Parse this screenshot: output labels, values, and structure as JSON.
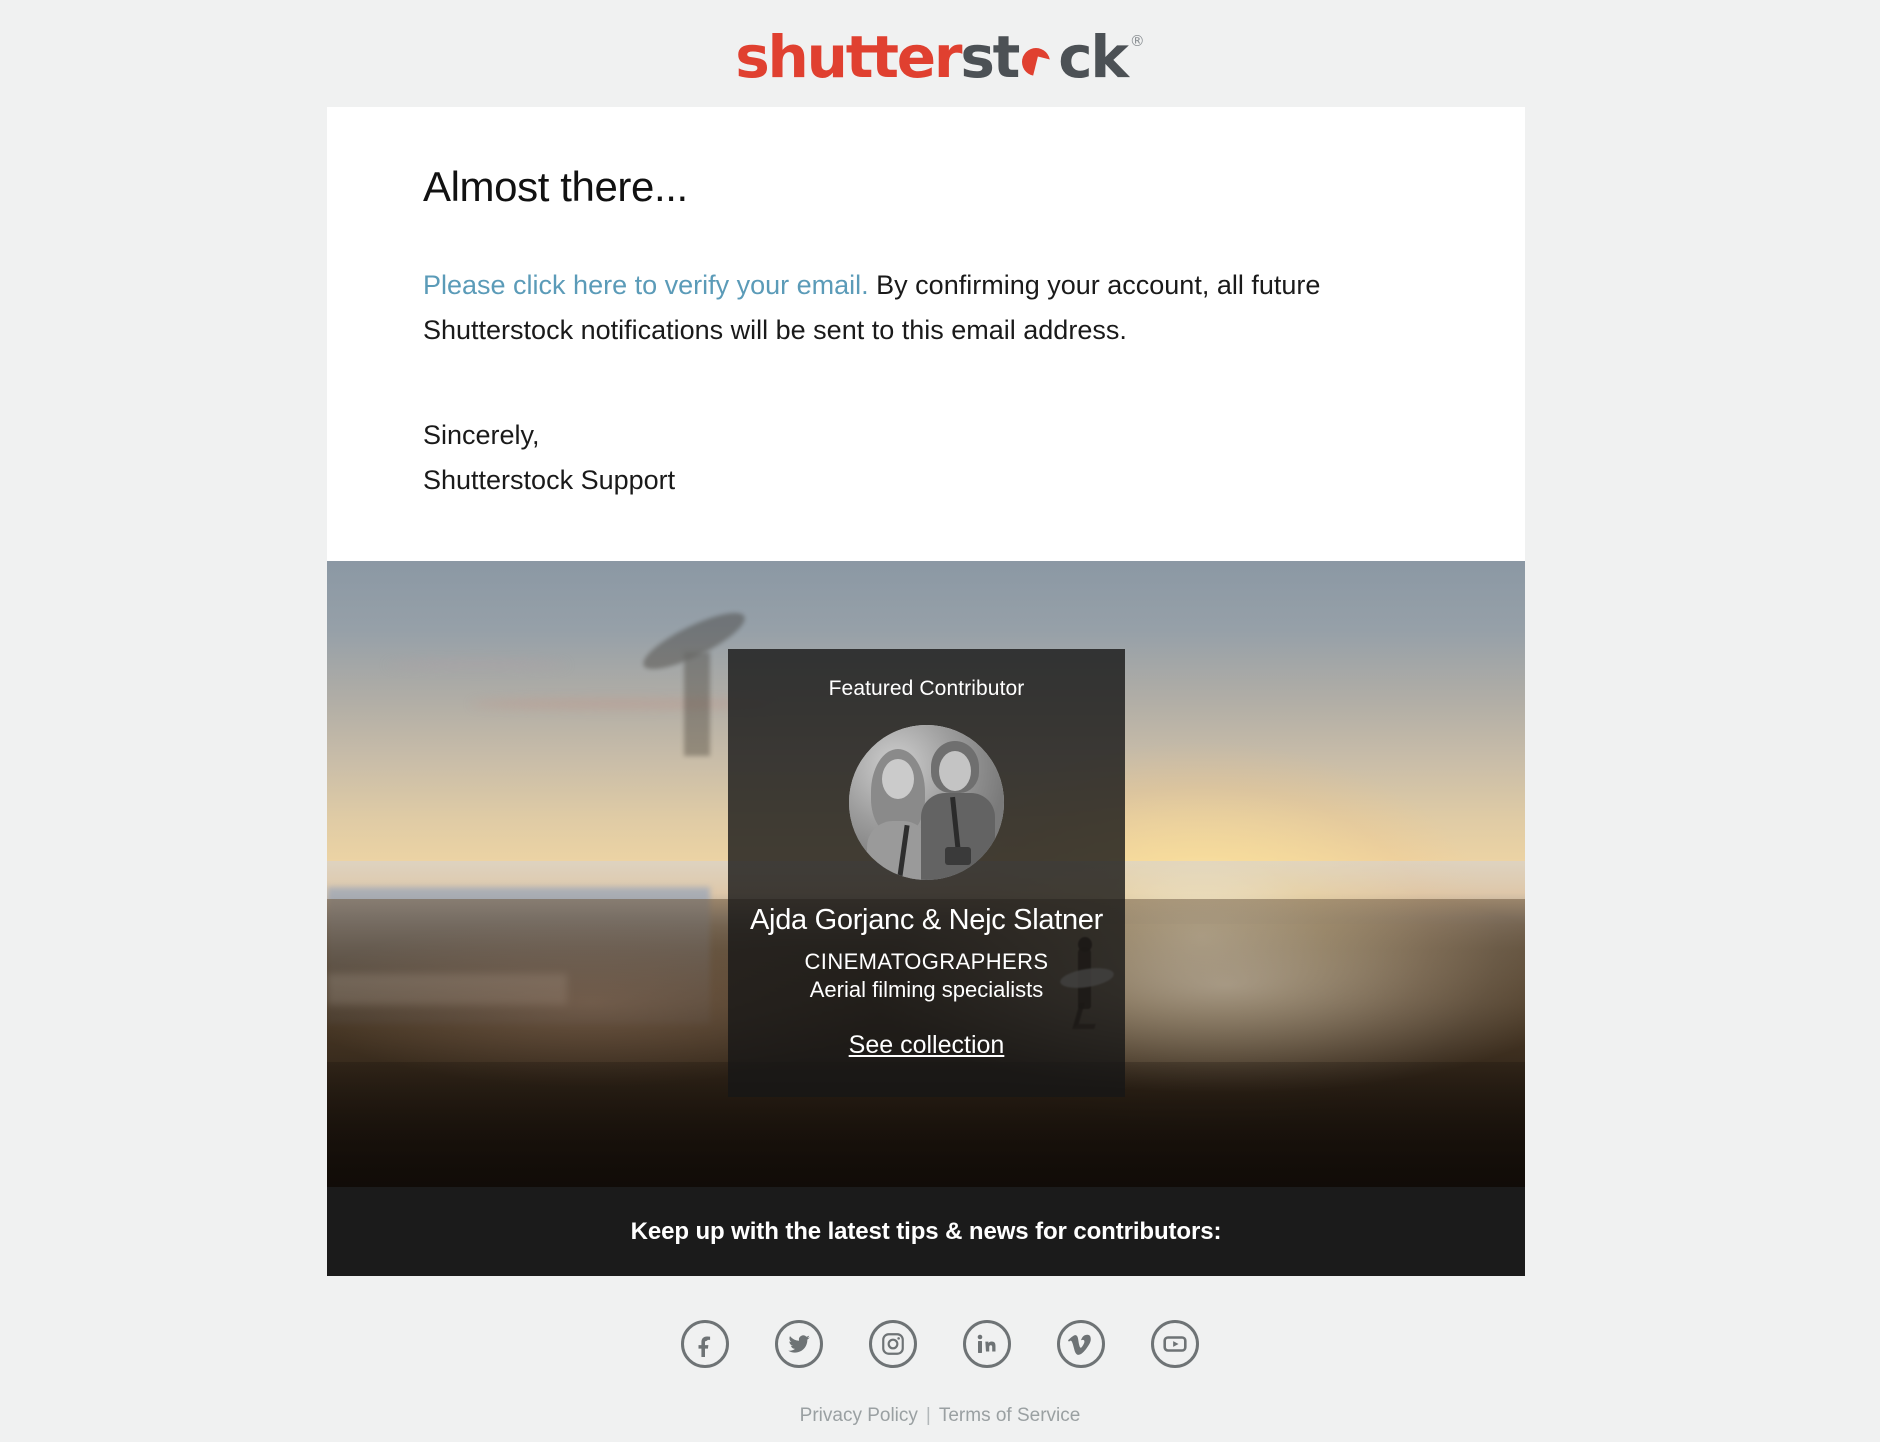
{
  "brand": {
    "logo_part1": "shutter",
    "logo_part2": "st",
    "logo_part3": "ck",
    "registered_mark": "®",
    "red": "#e04030",
    "dark": "#4c5155",
    "link_blue": "#5b9bb8",
    "page_background": "#f0f1f1",
    "strip_background": "#1b1b1b"
  },
  "message": {
    "headline": "Almost there...",
    "link_text": "Please click here to verify your email.",
    "body_text": " By confirming your account, all future Shutterstock notifications will be sent to this email address.",
    "signoff_line1": "Sincerely,",
    "signoff_line2": "Shutterstock Support"
  },
  "contributor": {
    "label": "Featured Contributor",
    "name": "Ajda Gorjanc & Nejc Slatner",
    "role": "CINEMATOGRAPHERS",
    "description": "Aerial filming specialists",
    "cta": "See collection",
    "avatar_alt": "avatar"
  },
  "newsletter": {
    "heading": "Keep up with the latest tips & news for contributors:"
  },
  "social": [
    {
      "name": "facebook-icon",
      "label": "Facebook"
    },
    {
      "name": "twitter-icon",
      "label": "Twitter"
    },
    {
      "name": "instagram-icon",
      "label": "Instagram"
    },
    {
      "name": "linkedin-icon",
      "label": "LinkedIn"
    },
    {
      "name": "vimeo-icon",
      "label": "Vimeo"
    },
    {
      "name": "youtube-icon",
      "label": "YouTube"
    }
  ],
  "legal": {
    "privacy": "Privacy Policy",
    "separator": "|",
    "terms": "Terms of Service"
  }
}
